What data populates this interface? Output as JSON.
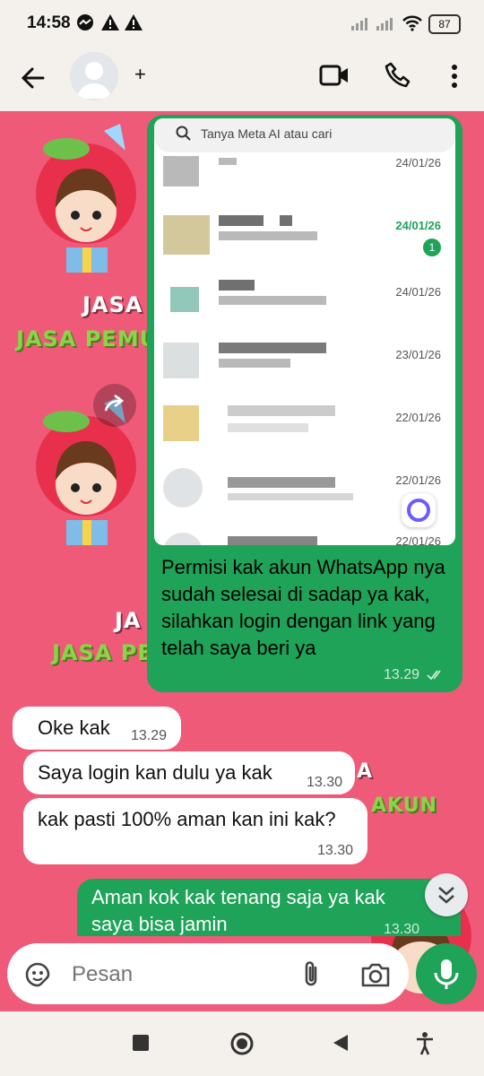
{
  "status_bar": {
    "time": "14:58",
    "battery": "87"
  },
  "header": {
    "contact_name": "+"
  },
  "screenshot": {
    "search_placeholder": "Tanya Meta AI atau cari",
    "rows": [
      {
        "date": "24/01/26"
      },
      {
        "date": "24/01/26",
        "unread": "1"
      },
      {
        "date": "24/01/26"
      },
      {
        "date": "23/01/26"
      },
      {
        "date": "22/01/26"
      },
      {
        "date": "22/01/26"
      },
      {
        "date": "22/01/26"
      }
    ]
  },
  "stickers": {
    "text1": "JASA",
    "text2": "JASA PEMU",
    "text3": "JA",
    "text4": "JASA PE",
    "text5": "A",
    "text6": "AKUN"
  },
  "messages": [
    {
      "text": "Permisi kak akun WhatsApp nya sudah selesai di sadap ya kak, silahkan login dengan link yang telah saya beri ya",
      "time": "13.29"
    },
    {
      "text": "Oke kak",
      "time": "13.29"
    },
    {
      "text": "Saya login kan dulu ya kak",
      "time": "13.30"
    },
    {
      "text": "kak pasti 100% aman kan ini kak?",
      "time": "13.30"
    },
    {
      "text": "Aman kok kak tenang saja ya kak saya bisa jamin",
      "time": "13.30"
    }
  ],
  "input": {
    "placeholder": "Pesan"
  },
  "colors": {
    "chat_bg": "#ef5a78",
    "outgoing": "#1ea359",
    "incoming": "#ffffff",
    "bars": "#f4f1ec"
  }
}
